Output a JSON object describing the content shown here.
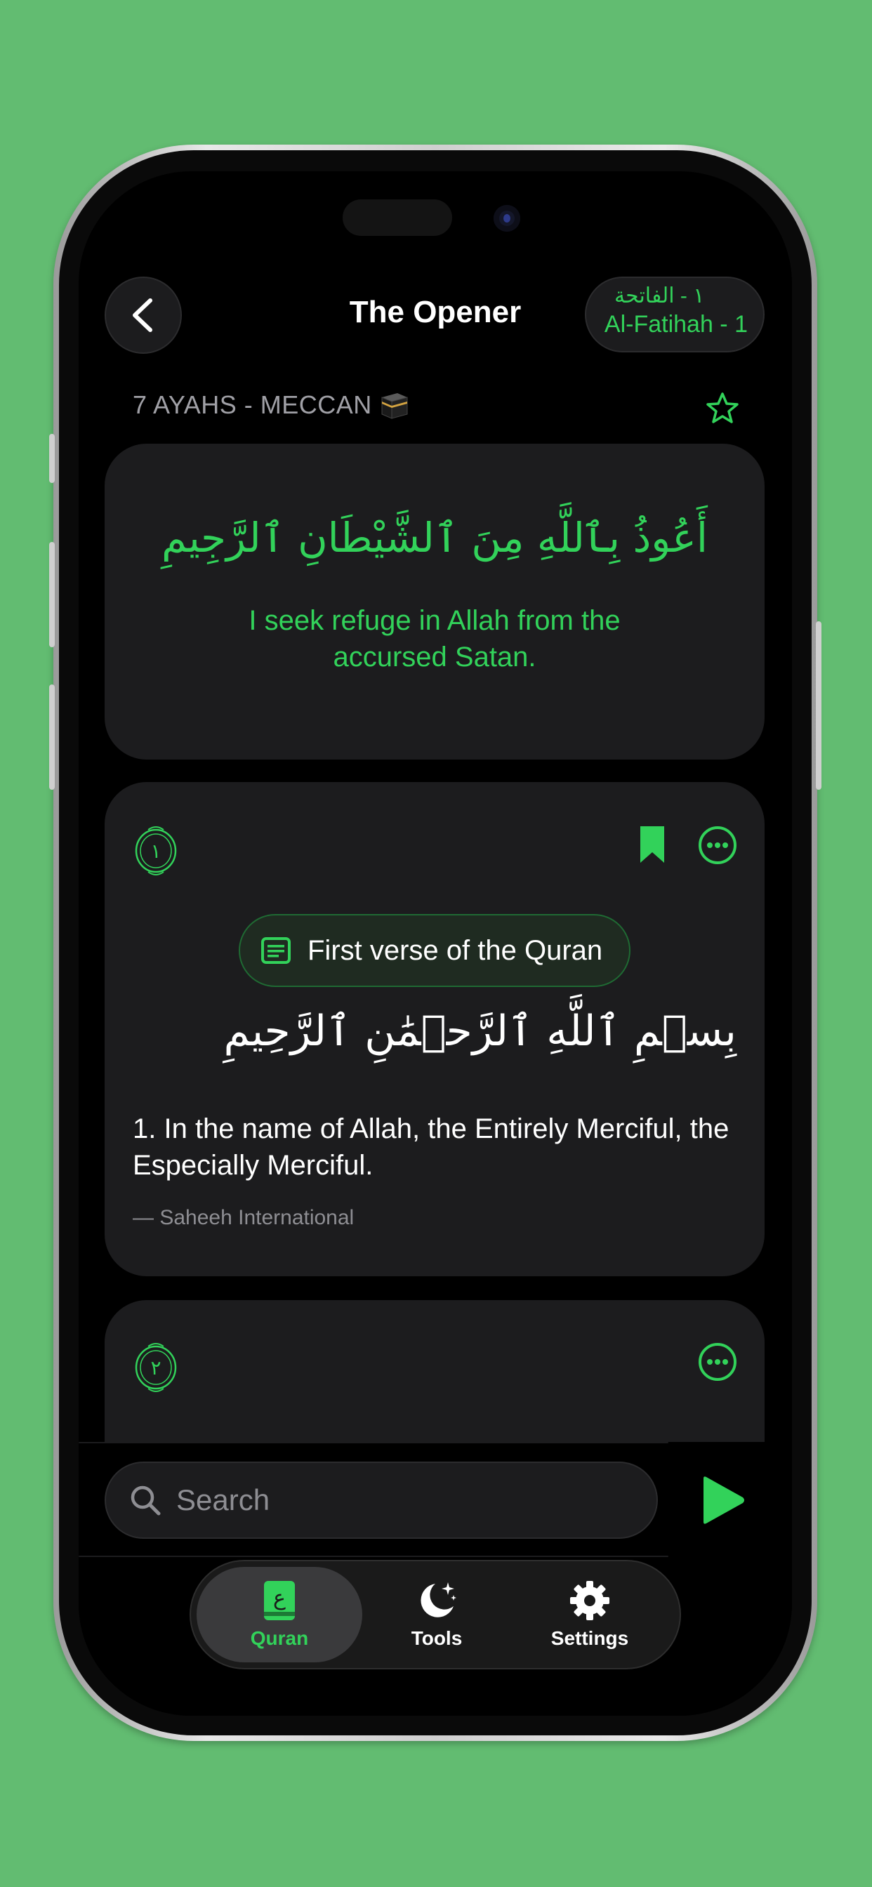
{
  "header": {
    "title": "The Opener",
    "surah_arabic": "١ - الفاتحة",
    "surah_english": "Al-Fatihah - 1"
  },
  "meta": {
    "text": "7 AYAHS - MECCAN"
  },
  "taawwudh": {
    "arabic": "أَعُوذُ بِٱللَّهِ مِنَ ٱلشَّيْطَانِ ٱلرَّجِيمِ",
    "translation": "I seek refuge in Allah from the accursed Satan."
  },
  "verses": [
    {
      "number_arabic": "١",
      "note": "First verse of the Quran",
      "arabic": "بِسۡمِ ٱللَّهِ ٱلرَّحۡمَٰنِ ٱلرَّحِيمِ",
      "translation": "1. In the name of Allah, the Entirely Merciful, the Especially Merciful.",
      "source": "— Saheeh International",
      "bookmarked": true
    },
    {
      "number_arabic": "٢"
    }
  ],
  "search": {
    "placeholder": "Search"
  },
  "tabs": [
    {
      "label": "Quran",
      "icon": "quran-book-icon",
      "active": true
    },
    {
      "label": "Tools",
      "icon": "moon-stars-icon",
      "active": false
    },
    {
      "label": "Settings",
      "icon": "gear-icon",
      "active": false
    }
  ],
  "colors": {
    "accent": "#32d25a",
    "background": "#62bc71",
    "card": "#1c1c1e"
  }
}
